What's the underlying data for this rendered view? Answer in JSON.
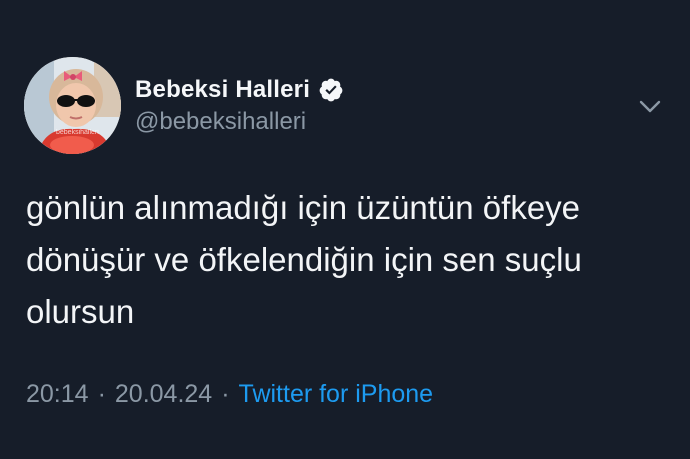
{
  "tweet": {
    "author": {
      "display_name": "Bebeksi Halleri",
      "handle": "@bebeksihalleri",
      "verified": true,
      "avatar_icon": "profile-photo-child-sunglasses",
      "avatar_watermark": "bebeksihalleri"
    },
    "text": "gönlün alınmadığı için üzüntün öfkeye\ndönüşür ve öfkelendiğin için sen suçlu\nolursun",
    "time": "20:14",
    "separator": "·",
    "date": "20.04.24",
    "source": "Twitter for iPhone",
    "menu_icon": "chevron-down-icon"
  },
  "colors": {
    "background": "#161d29",
    "text_primary": "#f3f5f7",
    "text_secondary": "#8b98a5",
    "link": "#1d9bf0"
  }
}
